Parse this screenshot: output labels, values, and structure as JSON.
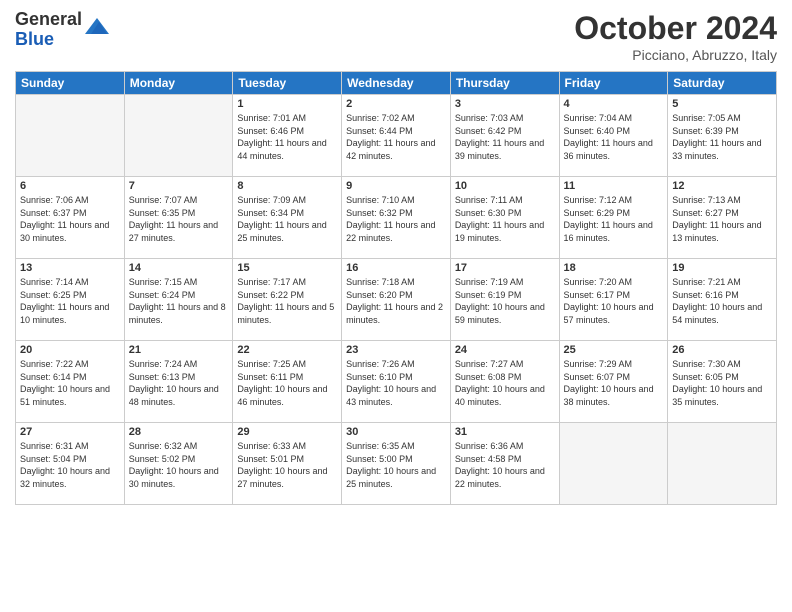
{
  "header": {
    "logo_general": "General",
    "logo_blue": "Blue",
    "month_title": "October 2024",
    "location": "Picciano, Abruzzo, Italy"
  },
  "weekdays": [
    "Sunday",
    "Monday",
    "Tuesday",
    "Wednesday",
    "Thursday",
    "Friday",
    "Saturday"
  ],
  "weeks": [
    [
      {
        "day": "",
        "info": ""
      },
      {
        "day": "",
        "info": ""
      },
      {
        "day": "1",
        "info": "Sunrise: 7:01 AM\nSunset: 6:46 PM\nDaylight: 11 hours and 44 minutes."
      },
      {
        "day": "2",
        "info": "Sunrise: 7:02 AM\nSunset: 6:44 PM\nDaylight: 11 hours and 42 minutes."
      },
      {
        "day": "3",
        "info": "Sunrise: 7:03 AM\nSunset: 6:42 PM\nDaylight: 11 hours and 39 minutes."
      },
      {
        "day": "4",
        "info": "Sunrise: 7:04 AM\nSunset: 6:40 PM\nDaylight: 11 hours and 36 minutes."
      },
      {
        "day": "5",
        "info": "Sunrise: 7:05 AM\nSunset: 6:39 PM\nDaylight: 11 hours and 33 minutes."
      }
    ],
    [
      {
        "day": "6",
        "info": "Sunrise: 7:06 AM\nSunset: 6:37 PM\nDaylight: 11 hours and 30 minutes."
      },
      {
        "day": "7",
        "info": "Sunrise: 7:07 AM\nSunset: 6:35 PM\nDaylight: 11 hours and 27 minutes."
      },
      {
        "day": "8",
        "info": "Sunrise: 7:09 AM\nSunset: 6:34 PM\nDaylight: 11 hours and 25 minutes."
      },
      {
        "day": "9",
        "info": "Sunrise: 7:10 AM\nSunset: 6:32 PM\nDaylight: 11 hours and 22 minutes."
      },
      {
        "day": "10",
        "info": "Sunrise: 7:11 AM\nSunset: 6:30 PM\nDaylight: 11 hours and 19 minutes."
      },
      {
        "day": "11",
        "info": "Sunrise: 7:12 AM\nSunset: 6:29 PM\nDaylight: 11 hours and 16 minutes."
      },
      {
        "day": "12",
        "info": "Sunrise: 7:13 AM\nSunset: 6:27 PM\nDaylight: 11 hours and 13 minutes."
      }
    ],
    [
      {
        "day": "13",
        "info": "Sunrise: 7:14 AM\nSunset: 6:25 PM\nDaylight: 11 hours and 10 minutes."
      },
      {
        "day": "14",
        "info": "Sunrise: 7:15 AM\nSunset: 6:24 PM\nDaylight: 11 hours and 8 minutes."
      },
      {
        "day": "15",
        "info": "Sunrise: 7:17 AM\nSunset: 6:22 PM\nDaylight: 11 hours and 5 minutes."
      },
      {
        "day": "16",
        "info": "Sunrise: 7:18 AM\nSunset: 6:20 PM\nDaylight: 11 hours and 2 minutes."
      },
      {
        "day": "17",
        "info": "Sunrise: 7:19 AM\nSunset: 6:19 PM\nDaylight: 10 hours and 59 minutes."
      },
      {
        "day": "18",
        "info": "Sunrise: 7:20 AM\nSunset: 6:17 PM\nDaylight: 10 hours and 57 minutes."
      },
      {
        "day": "19",
        "info": "Sunrise: 7:21 AM\nSunset: 6:16 PM\nDaylight: 10 hours and 54 minutes."
      }
    ],
    [
      {
        "day": "20",
        "info": "Sunrise: 7:22 AM\nSunset: 6:14 PM\nDaylight: 10 hours and 51 minutes."
      },
      {
        "day": "21",
        "info": "Sunrise: 7:24 AM\nSunset: 6:13 PM\nDaylight: 10 hours and 48 minutes."
      },
      {
        "day": "22",
        "info": "Sunrise: 7:25 AM\nSunset: 6:11 PM\nDaylight: 10 hours and 46 minutes."
      },
      {
        "day": "23",
        "info": "Sunrise: 7:26 AM\nSunset: 6:10 PM\nDaylight: 10 hours and 43 minutes."
      },
      {
        "day": "24",
        "info": "Sunrise: 7:27 AM\nSunset: 6:08 PM\nDaylight: 10 hours and 40 minutes."
      },
      {
        "day": "25",
        "info": "Sunrise: 7:29 AM\nSunset: 6:07 PM\nDaylight: 10 hours and 38 minutes."
      },
      {
        "day": "26",
        "info": "Sunrise: 7:30 AM\nSunset: 6:05 PM\nDaylight: 10 hours and 35 minutes."
      }
    ],
    [
      {
        "day": "27",
        "info": "Sunrise: 6:31 AM\nSunset: 5:04 PM\nDaylight: 10 hours and 32 minutes."
      },
      {
        "day": "28",
        "info": "Sunrise: 6:32 AM\nSunset: 5:02 PM\nDaylight: 10 hours and 30 minutes."
      },
      {
        "day": "29",
        "info": "Sunrise: 6:33 AM\nSunset: 5:01 PM\nDaylight: 10 hours and 27 minutes."
      },
      {
        "day": "30",
        "info": "Sunrise: 6:35 AM\nSunset: 5:00 PM\nDaylight: 10 hours and 25 minutes."
      },
      {
        "day": "31",
        "info": "Sunrise: 6:36 AM\nSunset: 4:58 PM\nDaylight: 10 hours and 22 minutes."
      },
      {
        "day": "",
        "info": ""
      },
      {
        "day": "",
        "info": ""
      }
    ]
  ]
}
